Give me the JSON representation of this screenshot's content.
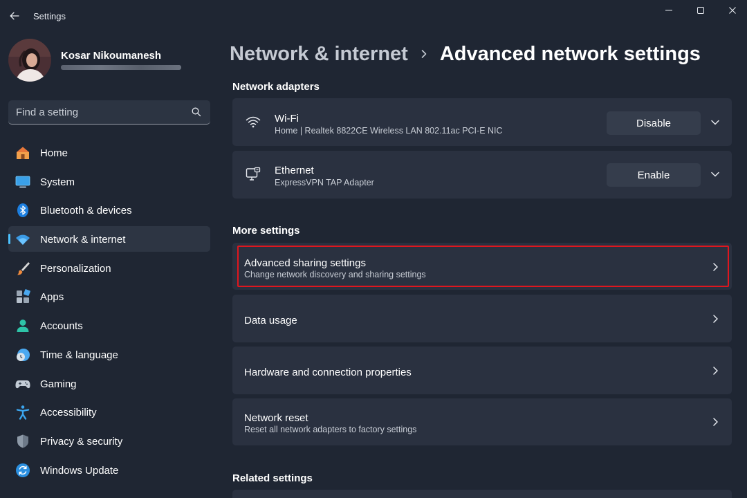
{
  "window": {
    "app_title": "Settings",
    "controls": [
      "minimize",
      "maximize",
      "close"
    ]
  },
  "user": {
    "name": "Kosar Nikoumanesh"
  },
  "search": {
    "placeholder": "Find a setting",
    "value": ""
  },
  "sidebar": {
    "items": [
      {
        "label": "Home",
        "icon": "home-icon"
      },
      {
        "label": "System",
        "icon": "system-icon"
      },
      {
        "label": "Bluetooth & devices",
        "icon": "bluetooth-icon"
      },
      {
        "label": "Network & internet",
        "icon": "wifi-icon",
        "active": true
      },
      {
        "label": "Personalization",
        "icon": "brush-icon"
      },
      {
        "label": "Apps",
        "icon": "apps-icon"
      },
      {
        "label": "Accounts",
        "icon": "accounts-icon"
      },
      {
        "label": "Time & language",
        "icon": "clock-globe-icon"
      },
      {
        "label": "Gaming",
        "icon": "gamepad-icon"
      },
      {
        "label": "Accessibility",
        "icon": "accessibility-icon"
      },
      {
        "label": "Privacy & security",
        "icon": "shield-icon"
      },
      {
        "label": "Windows Update",
        "icon": "update-icon"
      }
    ]
  },
  "breadcrumb": {
    "parent": "Network & internet",
    "current": "Advanced network settings"
  },
  "sections": {
    "adapters_title": "Network adapters",
    "more_title": "More settings",
    "related_title": "Related settings"
  },
  "adapters": [
    {
      "name": "Wi-Fi",
      "description": "Home | Realtek 8822CE Wireless LAN 802.11ac PCI-E NIC",
      "button": "Disable",
      "icon": "wifi-icon"
    },
    {
      "name": "Ethernet",
      "description": "ExpressVPN TAP Adapter",
      "button": "Enable",
      "icon": "ethernet-icon"
    }
  ],
  "more_settings": [
    {
      "title": "Advanced sharing settings",
      "subtitle": "Change network discovery and sharing settings",
      "highlighted": true
    },
    {
      "title": "Data usage",
      "subtitle": ""
    },
    {
      "title": "Hardware and connection properties",
      "subtitle": ""
    },
    {
      "title": "Network reset",
      "subtitle": "Reset all network adapters to factory settings"
    }
  ],
  "colors": {
    "background": "#1f2633",
    "card": "#2a3140",
    "accent": "#4cc2ff",
    "highlight_border": "#e0161e"
  }
}
